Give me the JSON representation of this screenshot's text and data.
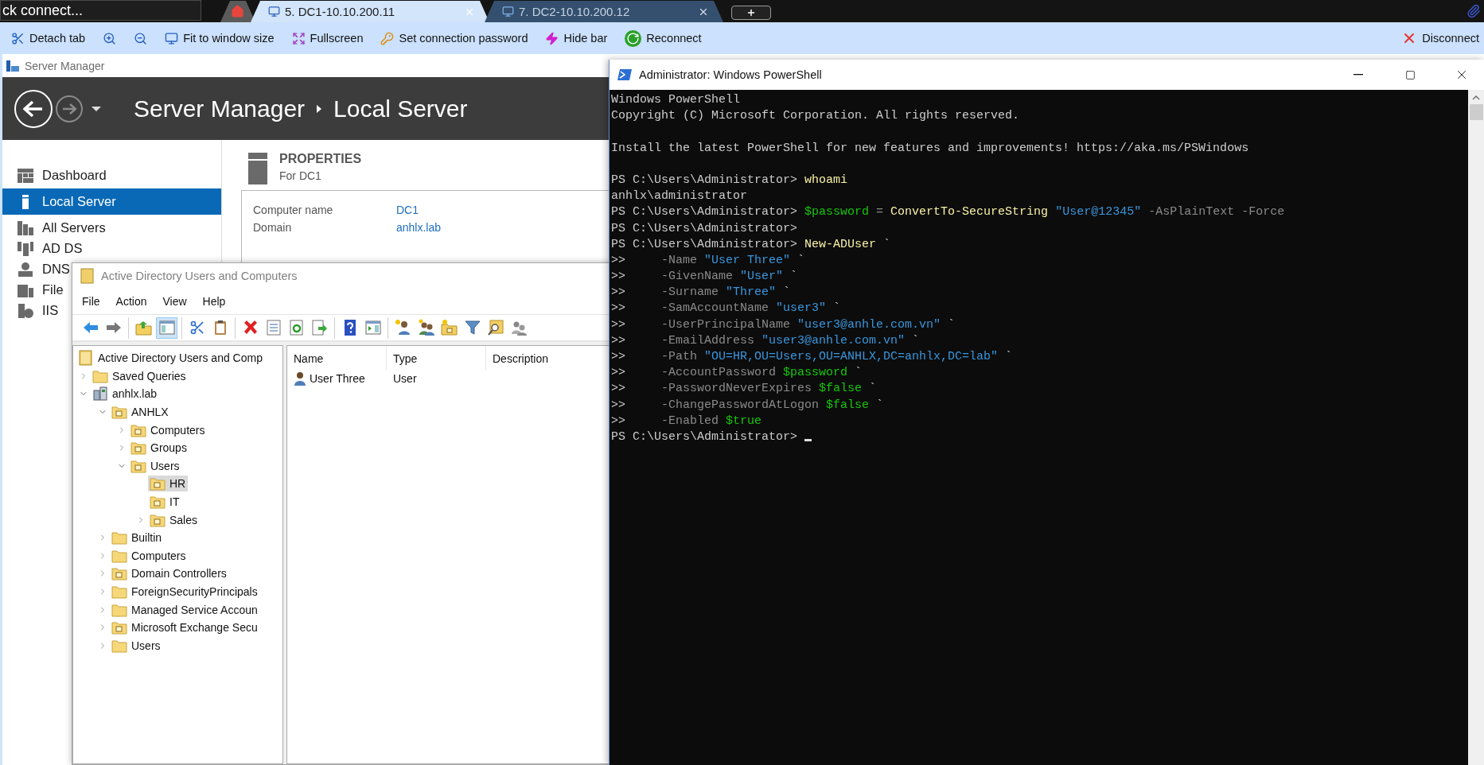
{
  "browser": {
    "quick_connect": {
      "value": "ck connect..."
    },
    "tabs": [
      {
        "kind": "home",
        "selected": false
      },
      {
        "kind": "remote",
        "label": "5. DC1-10.10.200.11",
        "selected": true
      },
      {
        "kind": "remote",
        "label": "7. DC2-10.10.200.12",
        "selected": false
      }
    ],
    "toolbar": [
      {
        "kind": "detach",
        "label": "Detach tab"
      },
      {
        "kind": "zoom-in"
      },
      {
        "kind": "zoom-out"
      },
      {
        "kind": "fit",
        "label": "Fit to window size"
      },
      {
        "kind": "fullscreen",
        "label": "Fullscreen"
      },
      {
        "kind": "password",
        "label": "Set connection password"
      },
      {
        "kind": "hide",
        "label": "Hide bar"
      },
      {
        "kind": "reconnect",
        "label": "Reconnect"
      }
    ],
    "disconnect": {
      "label": "Disconnect"
    }
  },
  "server_manager": {
    "title": "Server Manager",
    "breadcrumb": [
      "Server Manager",
      "Local Server"
    ],
    "nav": [
      {
        "kind": "dashboard",
        "label": "Dashboard",
        "selected": false
      },
      {
        "kind": "server",
        "label": "Local Server",
        "selected": true
      },
      {
        "kind": "servers",
        "label": "All Servers",
        "selected": false
      },
      {
        "kind": "adds",
        "label": "AD DS",
        "selected": false
      },
      {
        "kind": "dns",
        "label": "DNS",
        "selected": false
      },
      {
        "kind": "files",
        "label": "File",
        "selected": false
      },
      {
        "kind": "iis",
        "label": "IIS",
        "selected": false
      }
    ],
    "properties": {
      "heading": "PROPERTIES",
      "subheading": "For DC1",
      "fields": [
        {
          "label": "Computer name",
          "value": "DC1"
        },
        {
          "label": "Domain",
          "value": "anhlx.lab"
        }
      ]
    }
  },
  "aduc": {
    "title": "Active Directory Users and Computers",
    "menu": [
      "File",
      "Action",
      "View",
      "Help"
    ],
    "toolbar": [
      [
        {
          "kind": "back",
          "pressed": false
        },
        {
          "kind": "forward",
          "pressed": false
        }
      ],
      [
        {
          "kind": "up",
          "pressed": false
        },
        {
          "kind": "tree-toggle",
          "pressed": true
        }
      ],
      [
        {
          "kind": "cut",
          "pressed": false
        },
        {
          "kind": "paste",
          "pressed": false
        }
      ],
      [
        {
          "kind": "delete",
          "pressed": false
        },
        {
          "kind": "properties",
          "pressed": false
        },
        {
          "kind": "refresh",
          "pressed": false
        },
        {
          "kind": "export",
          "pressed": false
        }
      ],
      [
        {
          "kind": "help",
          "pressed": false
        },
        {
          "kind": "action-pane",
          "pressed": false
        }
      ],
      [
        {
          "kind": "new-user",
          "pressed": false
        },
        {
          "kind": "new-group",
          "pressed": false
        },
        {
          "kind": "new-ou",
          "pressed": false
        },
        {
          "kind": "filter",
          "pressed": false
        },
        {
          "kind": "find",
          "pressed": false
        },
        {
          "kind": "delegate",
          "pressed": false
        }
      ]
    ],
    "tree": [
      {
        "label": "Active Directory Users and Comp",
        "kind": "root",
        "selected": false,
        "children": [
          {
            "label": "Saved Queries",
            "kind": "folder",
            "expanded": false,
            "selected": false
          },
          {
            "label": "anhlx.lab",
            "kind": "domain",
            "expanded": true,
            "selected": false,
            "children": [
              {
                "label": "ANHLX",
                "kind": "ou",
                "expanded": true,
                "selected": false,
                "children": [
                  {
                    "label": "Computers",
                    "kind": "ou",
                    "expanded": false,
                    "selected": false
                  },
                  {
                    "label": "Groups",
                    "kind": "ou",
                    "expanded": false,
                    "selected": false
                  },
                  {
                    "label": "Users",
                    "kind": "ou",
                    "expanded": true,
                    "selected": false,
                    "children": [
                      {
                        "label": "HR",
                        "kind": "ou",
                        "selected": true
                      },
                      {
                        "label": "IT",
                        "kind": "ou",
                        "selected": false
                      },
                      {
                        "label": "Sales",
                        "kind": "ou",
                        "expanded": false,
                        "selected": false
                      }
                    ]
                  }
                ]
              },
              {
                "label": "Builtin",
                "kind": "folder",
                "expanded": false,
                "selected": false
              },
              {
                "label": "Computers",
                "kind": "folder",
                "expanded": false,
                "selected": false
              },
              {
                "label": "Domain Controllers",
                "kind": "ou",
                "expanded": false,
                "selected": false
              },
              {
                "label": "ForeignSecurityPrincipals",
                "kind": "folder",
                "expanded": false,
                "selected": false
              },
              {
                "label": "Managed Service Accoun",
                "kind": "folder",
                "expanded": false,
                "selected": false
              },
              {
                "label": "Microsoft Exchange Secu",
                "kind": "ou",
                "expanded": false,
                "selected": false
              },
              {
                "label": "Users",
                "kind": "folder",
                "expanded": false,
                "selected": false
              }
            ]
          }
        ]
      }
    ],
    "list": {
      "columns": [
        "Name",
        "Type",
        "Description"
      ],
      "rows": [
        {
          "kind": "user",
          "cells": [
            "User Three",
            "User"
          ]
        }
      ]
    }
  },
  "powershell": {
    "title": "Administrator: Windows PowerShell",
    "cursor": true,
    "blocks": [
      [
        [
          {
            "kind": "text",
            "text": "Windows PowerShell"
          }
        ],
        [
          {
            "kind": "text",
            "text": "Copyright (C) Microsoft Corporation. All rights reserved."
          }
        ]
      ],
      [
        [
          {
            "kind": "text",
            "text": "Install the latest PowerShell for new features and improvements! https://aka.ms/PSWindows"
          }
        ]
      ],
      [
        [
          {
            "kind": "text",
            "text": "PS C:\\Users\\Administrator> "
          },
          {
            "kind": "command",
            "text": "whoami"
          }
        ],
        [
          {
            "kind": "text",
            "text": "anhlx\\administrator"
          }
        ],
        [
          {
            "kind": "text",
            "text": "PS C:\\Users\\Administrator> "
          },
          {
            "kind": "variable",
            "text": "$password"
          },
          {
            "kind": "parameter",
            "text": " = "
          },
          {
            "kind": "command",
            "text": "ConvertTo-SecureString"
          },
          {
            "kind": "string",
            "text": " \"User@12345\""
          },
          {
            "kind": "parameter",
            "text": " -AsPlainText -Force"
          }
        ],
        [
          {
            "kind": "text",
            "text": "PS C:\\Users\\Administrator>"
          }
        ],
        [
          {
            "kind": "text",
            "text": "PS C:\\Users\\Administrator> "
          },
          {
            "kind": "command",
            "text": "New-ADUser"
          },
          {
            "kind": "text",
            "text": " `"
          }
        ],
        [
          {
            "kind": "text",
            "text": ">>"
          },
          {
            "kind": "parameter",
            "text": "     -Name "
          },
          {
            "kind": "string",
            "text": "\"User Three\""
          },
          {
            "kind": "text",
            "text": " `"
          }
        ],
        [
          {
            "kind": "text",
            "text": ">>"
          },
          {
            "kind": "parameter",
            "text": "     -GivenName "
          },
          {
            "kind": "string",
            "text": "\"User\""
          },
          {
            "kind": "text",
            "text": " `"
          }
        ],
        [
          {
            "kind": "text",
            "text": ">>"
          },
          {
            "kind": "parameter",
            "text": "     -Surname "
          },
          {
            "kind": "string",
            "text": "\"Three\""
          },
          {
            "kind": "text",
            "text": " `"
          }
        ],
        [
          {
            "kind": "text",
            "text": ">>"
          },
          {
            "kind": "parameter",
            "text": "     -SamAccountName "
          },
          {
            "kind": "string",
            "text": "\"user3\""
          },
          {
            "kind": "text",
            "text": " `"
          }
        ],
        [
          {
            "kind": "text",
            "text": ">>"
          },
          {
            "kind": "parameter",
            "text": "     -UserPrincipalName "
          },
          {
            "kind": "string",
            "text": "\"user3@anhle.com.vn\""
          },
          {
            "kind": "text",
            "text": " `"
          }
        ],
        [
          {
            "kind": "text",
            "text": ">>"
          },
          {
            "kind": "parameter",
            "text": "     -EmailAddress "
          },
          {
            "kind": "string",
            "text": "\"user3@anhle.com.vn\""
          },
          {
            "kind": "text",
            "text": " `"
          }
        ],
        [
          {
            "kind": "text",
            "text": ">>"
          },
          {
            "kind": "parameter",
            "text": "     -Path "
          },
          {
            "kind": "string",
            "text": "\"OU=HR,OU=Users,OU=ANHLX,DC=anhlx,DC=lab\""
          },
          {
            "kind": "text",
            "text": " `"
          }
        ],
        [
          {
            "kind": "text",
            "text": ">>"
          },
          {
            "kind": "parameter",
            "text": "     -AccountPassword "
          },
          {
            "kind": "variable",
            "text": "$password"
          },
          {
            "kind": "text",
            "text": " `"
          }
        ],
        [
          {
            "kind": "text",
            "text": ">>"
          },
          {
            "kind": "parameter",
            "text": "     -PasswordNeverExpires "
          },
          {
            "kind": "variable",
            "text": "$false"
          },
          {
            "kind": "text",
            "text": " `"
          }
        ],
        [
          {
            "kind": "text",
            "text": ">>"
          },
          {
            "kind": "parameter",
            "text": "     -ChangePasswordAtLogon "
          },
          {
            "kind": "variable",
            "text": "$false"
          },
          {
            "kind": "text",
            "text": " `"
          }
        ],
        [
          {
            "kind": "text",
            "text": ">>"
          },
          {
            "kind": "parameter",
            "text": "     -Enabled "
          },
          {
            "kind": "variable",
            "text": "$true"
          }
        ],
        [
          {
            "kind": "text",
            "text": "PS C:\\Users\\Administrator> "
          }
        ]
      ]
    ]
  }
}
